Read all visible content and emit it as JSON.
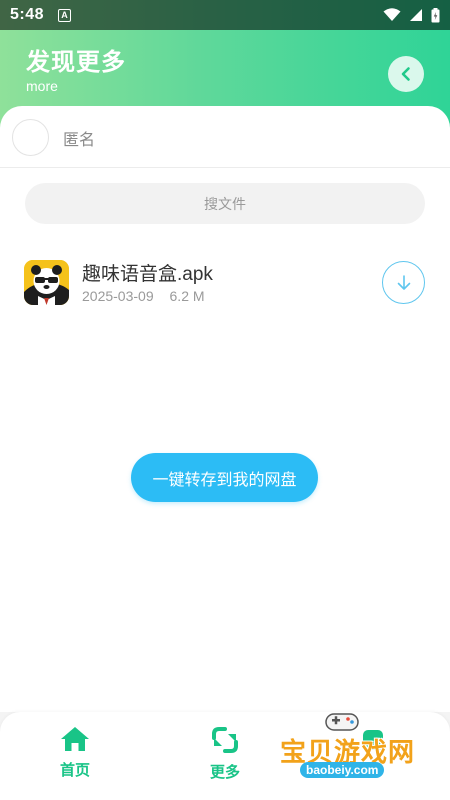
{
  "status_bar": {
    "time": "5:48",
    "notification_icon": "a-box-icon",
    "icons": [
      "wifi-icon",
      "signal-icon",
      "battery-icon"
    ]
  },
  "header": {
    "title": "发现更多",
    "subtitle": "more",
    "back_icon": "chevron-left-icon"
  },
  "user": {
    "name": "匿名"
  },
  "search": {
    "placeholder": "搜文件"
  },
  "files": [
    {
      "name": "趣味语音盒.apk",
      "date": "2025-03-09",
      "size": "6.2 M",
      "icon": "panda-app-icon",
      "action_icon": "download-arrow-icon"
    }
  ],
  "save_button": {
    "label": "一键转存到我的网盘"
  },
  "bottom_nav": {
    "items": [
      {
        "label": "首页",
        "icon": "home-icon"
      },
      {
        "label": "更多",
        "icon": "refresh-arrows-icon"
      },
      {
        "label": "",
        "icon": "tab-icon"
      }
    ]
  },
  "watermark": {
    "text": "宝贝游戏网",
    "url": "baobeiy.com"
  },
  "colors": {
    "accent_green": "#19c487",
    "header_gradient_start": "#8fe19a",
    "header_gradient_end": "#2fd497",
    "button_blue": "#2cbcf5",
    "download_ring": "#5fc6ee"
  }
}
